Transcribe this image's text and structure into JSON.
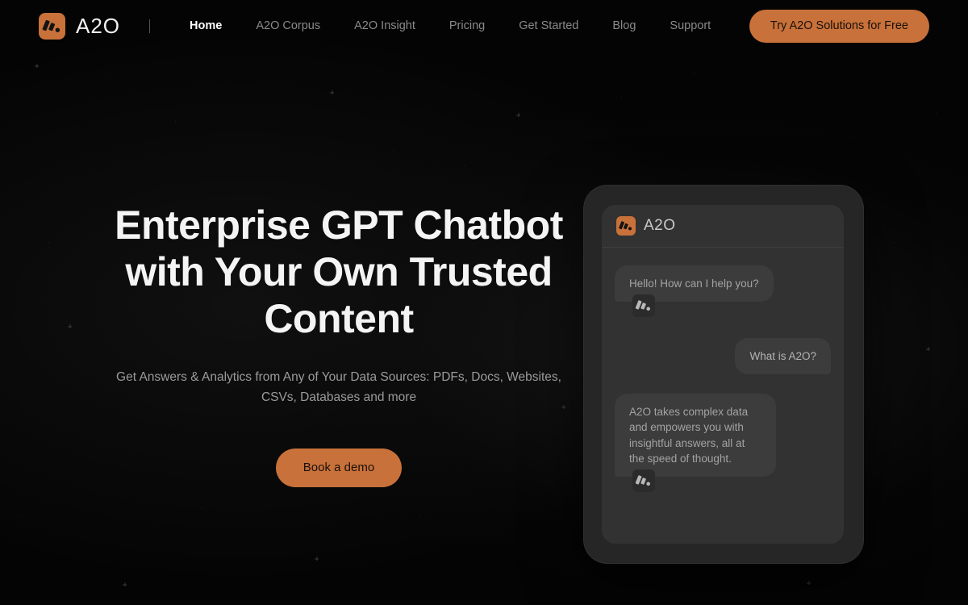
{
  "brand": {
    "name": "A2O",
    "logo_icon": "a2o-bars-logo-icon",
    "accent_color": "#C8713A",
    "background_color": "#040404"
  },
  "header": {
    "divider": "nav-divider",
    "nav_items": [
      {
        "label": "Home",
        "active": true
      },
      {
        "label": "A2O Corpus",
        "active": false
      },
      {
        "label": "A2O Insight",
        "active": false
      },
      {
        "label": "Pricing",
        "active": false
      },
      {
        "label": "Get Started",
        "active": false
      },
      {
        "label": "Blog",
        "active": false
      },
      {
        "label": "Support",
        "active": false
      }
    ],
    "cta_label": "Try A2O Solutions for Free"
  },
  "hero": {
    "headline": "Enterprise GPT Chatbot with Your Own Trusted Content",
    "subheadline": "Get Answers & Analytics from Any of Your Data Sources: PDFs, Docs, Websites, CSVs, Databases and more",
    "cta_label": "Book a demo"
  },
  "chat_mock": {
    "header_title": "A2O",
    "header_logo_icon": "a2o-bars-logo-icon",
    "messages": [
      {
        "sender": "bot",
        "text": "Hello! How can I help you?",
        "avatar_icon": "a2o-bars-avatar-icon"
      },
      {
        "sender": "user",
        "text": "What is A2O?"
      },
      {
        "sender": "bot",
        "text": "A2O takes complex data and empowers you with insightful answers, all at the speed of thought.",
        "avatar_icon": "a2o-bars-avatar-icon"
      }
    ]
  }
}
